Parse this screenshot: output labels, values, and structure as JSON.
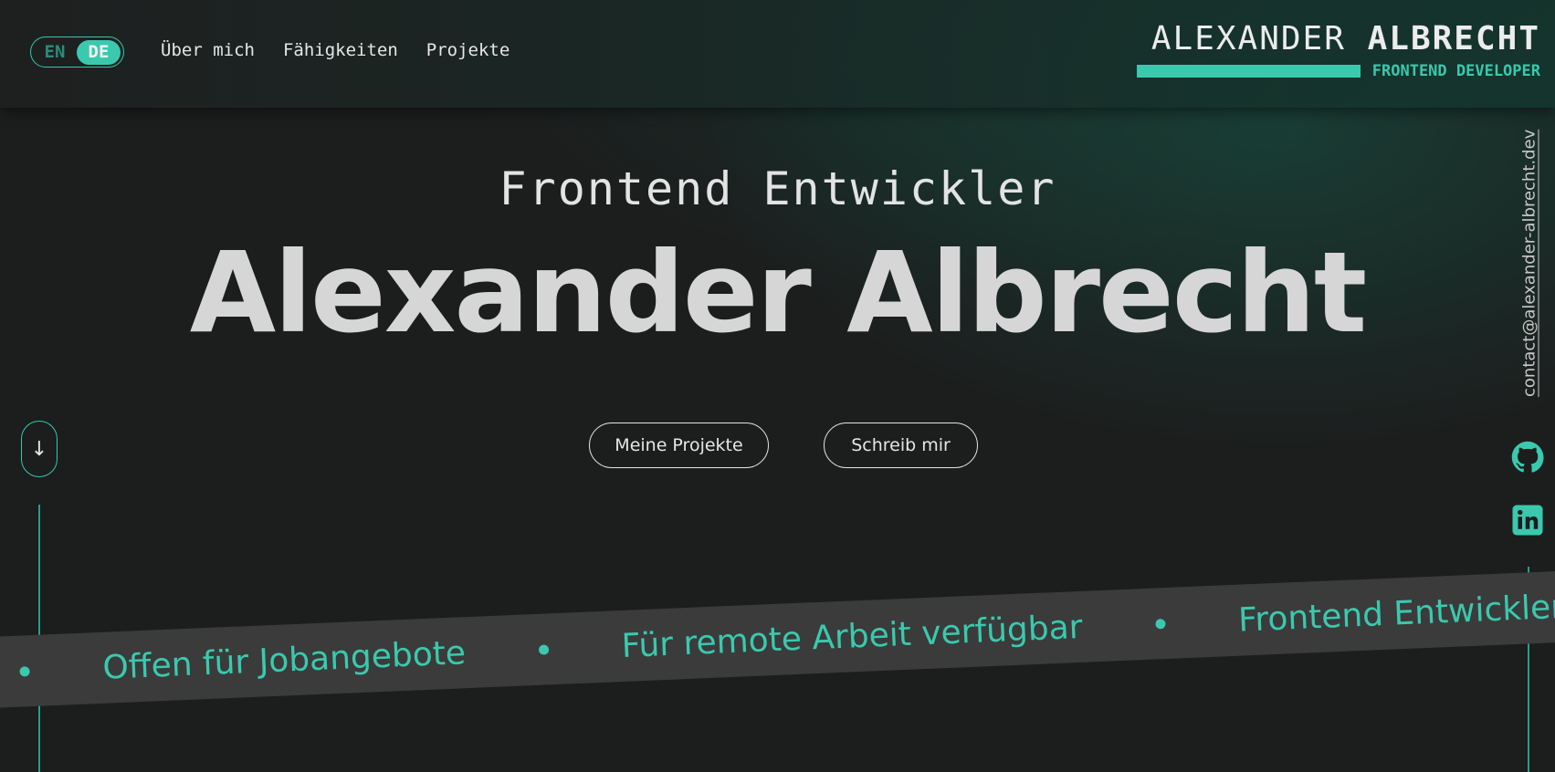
{
  "header": {
    "lang_toggle": {
      "options": [
        "EN",
        "DE"
      ],
      "active": "DE"
    },
    "nav": [
      "Über mich",
      "Fähigkeiten",
      "Projekte"
    ],
    "brand": {
      "first": "ALEXANDER",
      "last": "ALBRECHT",
      "role": "FRONTEND DEVELOPER"
    }
  },
  "hero": {
    "subtitle": "Frontend Entwickler",
    "title": "Alexander Albrecht",
    "buttons": {
      "projects": "Meine Projekte",
      "contact": "Schreib mir"
    }
  },
  "scroll": {
    "icon": "arrow-down-icon",
    "glyph": "↓"
  },
  "sidebar": {
    "email": "contact@alexander-albrecht.dev",
    "icons": [
      "github-icon",
      "linkedin-icon"
    ]
  },
  "ribbon": {
    "items": [
      "Offen für Jobangebote",
      "Für remote Arbeit verfügbar",
      "Frontend Entwickler"
    ]
  },
  "colors": {
    "accent": "#3ac9ae",
    "background": "#1c1d1d",
    "ribbon": "#3b3b3b"
  }
}
